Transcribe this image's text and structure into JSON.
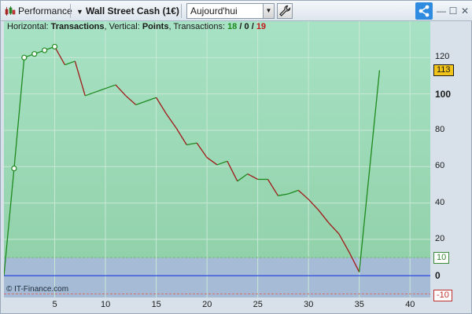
{
  "toolbar": {
    "app_label": "Performance",
    "instrument": "Wall Street Cash (1€)",
    "period": "Aujourd'hui",
    "accent_color": "#2e8be0"
  },
  "chart_header": {
    "horizontal_label": "Horizontal:",
    "horizontal_value": "Transactions",
    "vertical_label": "Vertical:",
    "vertical_value": "Points",
    "transactions_label": "Transactions:",
    "wins": "18",
    "sep1": "/",
    "neutral": "0",
    "sep2": "/",
    "losses": "19"
  },
  "watermark": "© IT-Finance.com",
  "chart_data": {
    "type": "line",
    "xlabel": "",
    "ylabel": "",
    "xlim": [
      0,
      42
    ],
    "ylim": [
      -12,
      140
    ],
    "xticks": [
      5,
      10,
      15,
      20,
      25,
      30,
      35,
      40
    ],
    "yticks": [
      20,
      40,
      60,
      80,
      100,
      120
    ],
    "zero_tick": "0",
    "current_value_label": "113",
    "upper_band": 10,
    "lower_band": -10,
    "upper_band_label": "10",
    "lower_band_label": "-10",
    "colors": {
      "gain": "#1e8a1e",
      "loss": "#a01818",
      "zero_line": "#1a3adf",
      "band_upper": "#6fbf6f",
      "band_lower": "#d86b6b"
    },
    "points": [
      [
        0,
        0
      ],
      [
        1,
        59
      ],
      [
        2,
        120
      ],
      [
        3,
        122
      ],
      [
        4,
        124
      ],
      [
        5,
        126
      ],
      [
        6,
        116
      ],
      [
        7,
        118
      ],
      [
        8,
        99
      ],
      [
        9,
        101
      ],
      [
        10,
        103
      ],
      [
        11,
        105
      ],
      [
        12,
        99
      ],
      [
        13,
        94
      ],
      [
        14,
        96
      ],
      [
        15,
        98
      ],
      [
        16,
        89
      ],
      [
        17,
        81
      ],
      [
        18,
        72
      ],
      [
        19,
        73
      ],
      [
        20,
        65
      ],
      [
        21,
        61
      ],
      [
        22,
        63
      ],
      [
        23,
        52
      ],
      [
        24,
        56
      ],
      [
        25,
        53
      ],
      [
        26,
        53
      ],
      [
        27,
        44
      ],
      [
        28,
        45
      ],
      [
        29,
        47
      ],
      [
        30,
        42
      ],
      [
        31,
        36
      ],
      [
        32,
        29
      ],
      [
        33,
        23
      ],
      [
        34,
        13
      ],
      [
        35,
        2
      ],
      [
        37,
        113
      ]
    ],
    "marked_points": [
      1,
      2,
      3,
      4,
      5
    ]
  }
}
